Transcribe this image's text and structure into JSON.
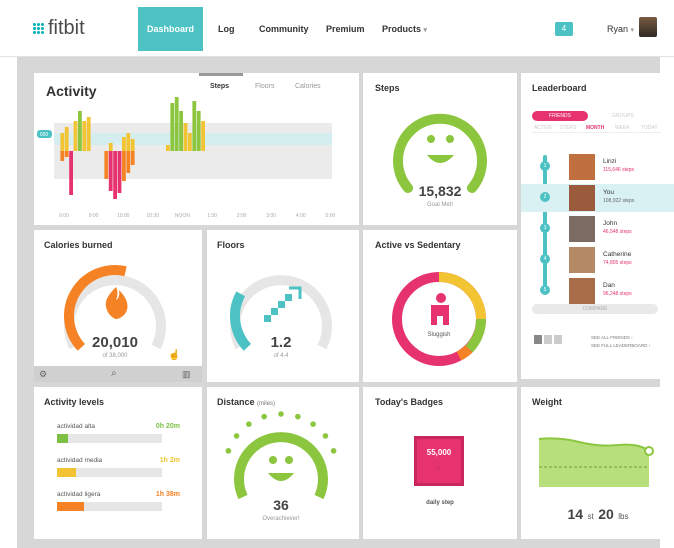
{
  "header": {
    "logo_text": "fitbit",
    "nav": [
      {
        "label": "Dashboard",
        "active": true
      },
      {
        "label": "Log"
      },
      {
        "label": "Community"
      },
      {
        "label": "Premium"
      },
      {
        "label": "Products"
      }
    ],
    "notification_count": "4",
    "user_name": "Ryan"
  },
  "activity": {
    "title": "Activity",
    "tabs": [
      "Steps",
      "Floors",
      "Calories"
    ],
    "goal_label": "650",
    "times": [
      "6:00",
      "9:00",
      "10:00",
      "10:30",
      "NOON",
      "1:30",
      "2:00",
      "3:00",
      "4:00",
      "5:00"
    ]
  },
  "steps": {
    "title": "Steps",
    "value": "15,832",
    "caption": "Goal Met!"
  },
  "leaderboard": {
    "title": "Leaderboard",
    "tabs": [
      "FRIENDS",
      "GROUPS"
    ],
    "periods": [
      "ACTIVE",
      "STEPS",
      "MONTH",
      "WEEK",
      "TODAY"
    ],
    "entries": [
      {
        "rank": "1",
        "name": "Linzi",
        "steps": "115,646 steps"
      },
      {
        "rank": "2",
        "name": "You",
        "steps": "108,922 steps"
      },
      {
        "rank": "3",
        "name": "John",
        "steps": "46,548 steps"
      },
      {
        "rank": "4",
        "name": "Catherine",
        "steps": "74,805 steps"
      },
      {
        "rank": "5",
        "name": "Dan",
        "steps": "96,248 steps"
      }
    ],
    "compare_label": "COMPARE",
    "see_all": "SEE ALL FRIENDS ›",
    "see_full": "SEE FULL LEADERBOARD ›"
  },
  "calories": {
    "title": "Calories burned",
    "value": "20,010",
    "caption": "of 38,000",
    "progress": 0.55
  },
  "floors": {
    "title": "Floors",
    "value": "1.2",
    "caption": "of 4.4",
    "progress": 0.27
  },
  "active_sedentary": {
    "title": "Active vs Sedentary",
    "status": "Sluggish"
  },
  "activity_levels": {
    "title": "Activity levels",
    "items": [
      {
        "label": "actividad alta",
        "value": "0h 20m",
        "color": "#7bc043",
        "fill": 0.1
      },
      {
        "label": "actividad media",
        "value": "1h 2m",
        "color": "#f2c333",
        "fill": 0.18
      },
      {
        "label": "actividad ligera",
        "value": "1h 38m",
        "color": "#f58225",
        "fill": 0.26
      }
    ]
  },
  "distance": {
    "title": "Distance",
    "unit": "(miles)",
    "value": "36",
    "caption": "Overachiever!"
  },
  "badges": {
    "title": "Today's Badges",
    "badge_value": "55,000",
    "badge_caption": "daily step"
  },
  "weight": {
    "title": "Weight",
    "value_st": "14",
    "unit_st": "st",
    "value_lbs": "20",
    "unit_lbs": "lbs"
  },
  "colors": {
    "teal": "#4cc2c4",
    "green": "#8cc63f",
    "orange": "#f58225",
    "pink": "#e6336f",
    "yellow": "#f2c333"
  }
}
